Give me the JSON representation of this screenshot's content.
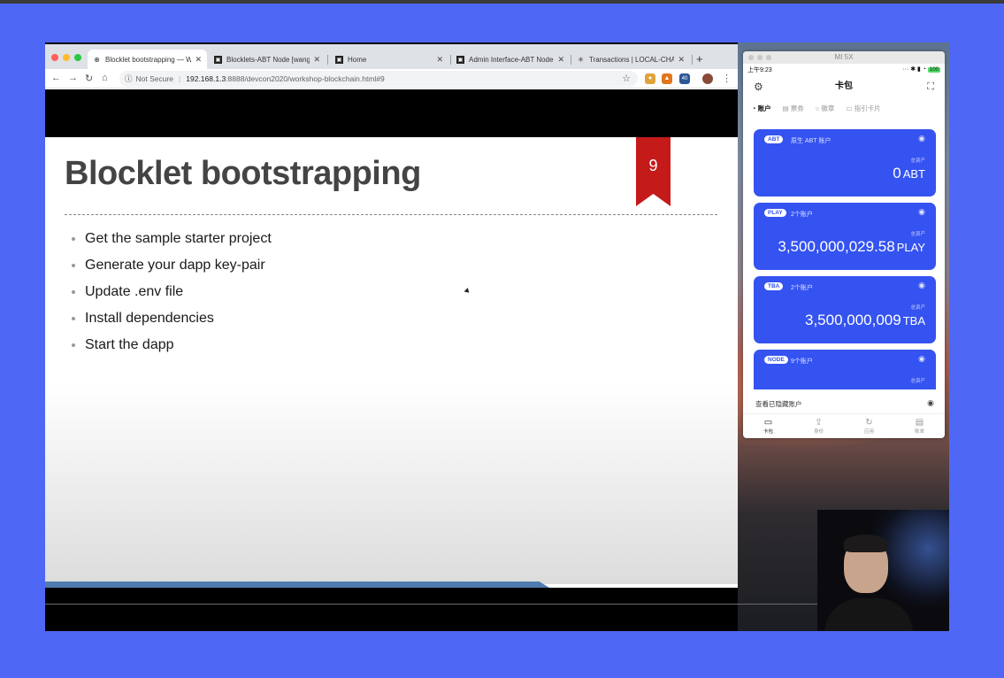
{
  "browser": {
    "tabs": [
      {
        "title": "Blocklet bootstrapping — W",
        "active": true,
        "favicon": "globe-icon"
      },
      {
        "title": "Blocklets-ABT Node [wangs",
        "active": false,
        "favicon": "abt-node-icon"
      },
      {
        "title": "Home",
        "active": false,
        "favicon": "abt-node-icon"
      },
      {
        "title": "Admin Interface-ABT Node",
        "active": false,
        "favicon": "abt-node-icon"
      },
      {
        "title": "Transactions | LOCAL-CHAI",
        "active": false,
        "favicon": "loading-icon"
      }
    ],
    "security_label": "Not Secure",
    "url_host": "192.168.1.3",
    "url_path": ":8888/devcon2020/workshop-blockchain.html#9",
    "ext_badge": "40"
  },
  "slide": {
    "title": "Blocklet bootstrapping",
    "number": "9",
    "bullets": [
      "Get the sample starter project",
      "Generate your dapp key-pair",
      "Update .env file",
      "Install dependencies",
      "Start the dapp"
    ]
  },
  "phone": {
    "window_title": "MI 5X",
    "time": "上午9:23",
    "battery": "100",
    "app_title": "卡包",
    "subtabs": [
      "账户",
      "票券",
      "徽章",
      "指引卡片"
    ],
    "total_label": "总资产",
    "cards": [
      {
        "badge": "ABT",
        "sub": "原生 ABT 账户",
        "amount": "0",
        "unit": "ABT"
      },
      {
        "badge": "PLAY",
        "sub": "2个账户",
        "amount": "3,500,000,029.58",
        "unit": "PLAY"
      },
      {
        "badge": "TBA",
        "sub": "2个账户",
        "amount": "3,500,000,009",
        "unit": "TBA"
      },
      {
        "badge": "NODE",
        "sub": "9个账户",
        "amount": "",
        "unit": ""
      }
    ],
    "hidden_accounts": "查看已隐藏账户",
    "nav": [
      "卡包",
      "身份",
      "应用",
      "账单"
    ]
  },
  "colors": {
    "background": "#4f67f5",
    "card_blue": "#3553f0",
    "bookmark_red": "#c41a1a"
  }
}
